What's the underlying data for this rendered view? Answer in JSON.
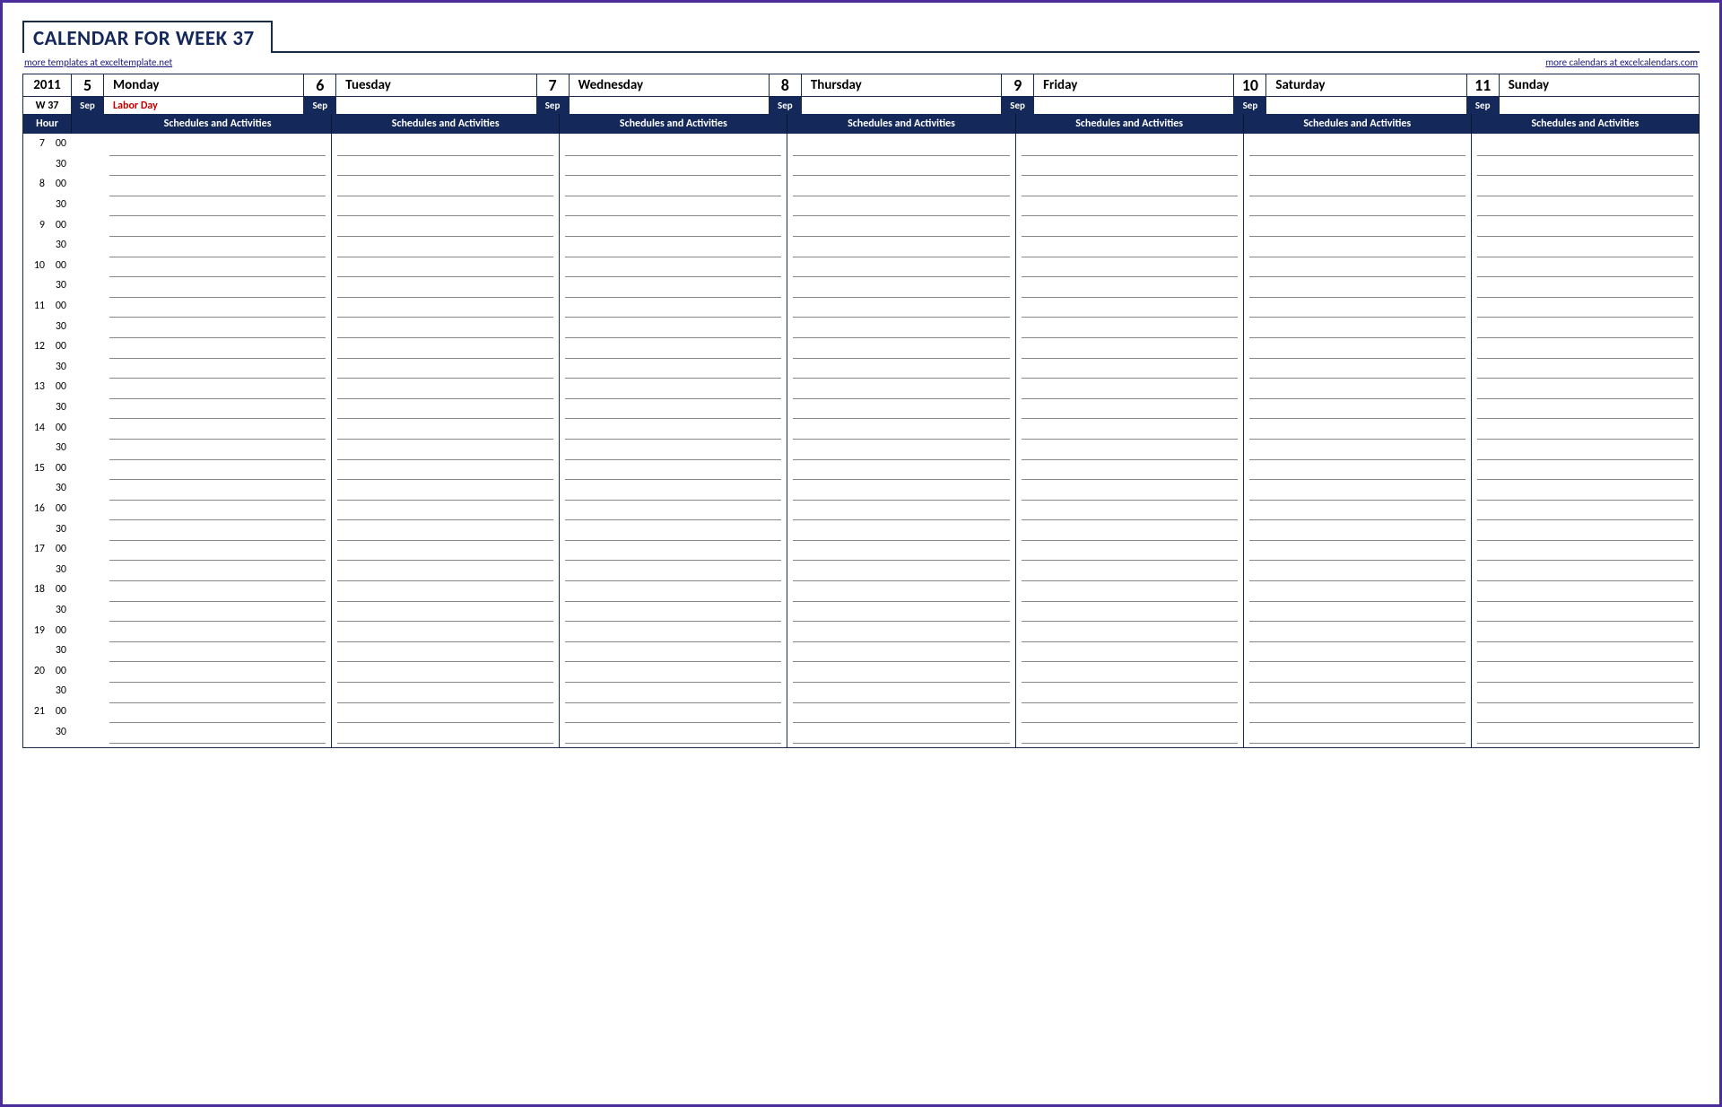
{
  "title": "CALENDAR FOR WEEK 37",
  "links": {
    "left": "more templates at exceltemplate.net",
    "right": "more calendars at excelcalendars.com"
  },
  "header": {
    "year": "2011",
    "week_label": "W 37",
    "hour_label": "Hour",
    "sched_label": "Schedules and Activities",
    "days": [
      {
        "date": "5",
        "month": "Sep",
        "name": "Monday",
        "event": "Labor Day"
      },
      {
        "date": "6",
        "month": "Sep",
        "name": "Tuesday",
        "event": ""
      },
      {
        "date": "7",
        "month": "Sep",
        "name": "Wednesday",
        "event": ""
      },
      {
        "date": "8",
        "month": "Sep",
        "name": "Thursday",
        "event": ""
      },
      {
        "date": "9",
        "month": "Sep",
        "name": "Friday",
        "event": ""
      },
      {
        "date": "10",
        "month": "Sep",
        "name": "Saturday",
        "event": ""
      },
      {
        "date": "11",
        "month": "Sep",
        "name": "Sunday",
        "event": ""
      }
    ]
  },
  "hours": [
    7,
    8,
    9,
    10,
    11,
    12,
    13,
    14,
    15,
    16,
    17,
    18,
    19,
    20,
    21
  ],
  "minutes": [
    "00",
    "30"
  ]
}
